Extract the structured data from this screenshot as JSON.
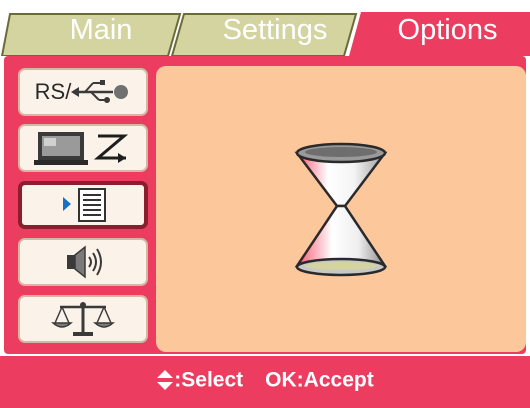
{
  "tabs": [
    {
      "label": "Main",
      "active": false
    },
    {
      "label": "Settings",
      "active": false
    },
    {
      "label": "Options",
      "active": true
    }
  ],
  "menu": {
    "items": [
      {
        "name": "rs-usb",
        "text": "RS/",
        "icon": "usb-icon",
        "selected": false
      },
      {
        "name": "display",
        "icon": "monitor-tv-icon",
        "selected": false
      },
      {
        "name": "list",
        "icon": "list-icon",
        "selected": true
      },
      {
        "name": "sound",
        "icon": "speaker-icon",
        "selected": false
      },
      {
        "name": "balance",
        "icon": "scales-icon",
        "selected": false
      }
    ]
  },
  "preview": {
    "icon": "hourglass-icon"
  },
  "footer": {
    "select_glyph": "⬍",
    "select_label": ":Select",
    "accept_label": "OK:Accept"
  },
  "colors": {
    "accent": "#ec3d61",
    "inactive_tab": "#d4d4a0",
    "preview_bg": "#fdc79c",
    "button_bg": "#fbf3ea",
    "selected_border": "#8b1e2e"
  }
}
